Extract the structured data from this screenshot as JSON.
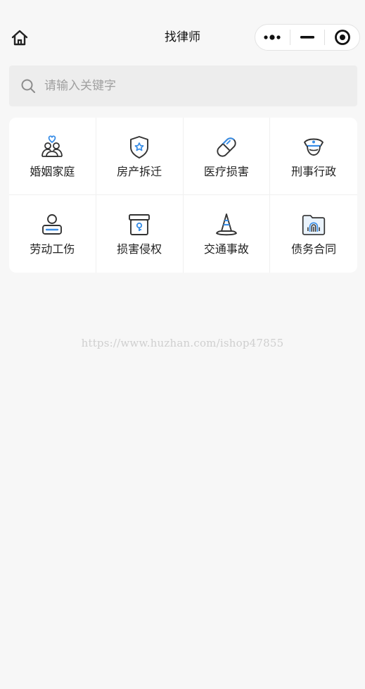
{
  "navbar": {
    "title": "找律师",
    "home_icon": "home-icon",
    "capsule": {
      "more_icon": "more-dots-icon",
      "minimize_icon": "minimize-icon",
      "close_icon": "target-circle-icon"
    }
  },
  "search": {
    "placeholder": "请输入关键字",
    "value": "",
    "icon": "search-icon"
  },
  "categories": [
    {
      "label": "婚姻家庭",
      "icon": "couple-heart-icon"
    },
    {
      "label": "房产拆迁",
      "icon": "shield-badge-icon"
    },
    {
      "label": "医疗损害",
      "icon": "pill-capsule-icon"
    },
    {
      "label": "刑事行政",
      "icon": "police-cap-icon"
    },
    {
      "label": "劳动工伤",
      "icon": "worker-person-icon"
    },
    {
      "label": "损害侵权",
      "icon": "evidence-box-icon"
    },
    {
      "label": "交通事故",
      "icon": "traffic-cone-icon"
    },
    {
      "label": "债务合同",
      "icon": "folder-fingerprint-icon"
    }
  ],
  "watermark": "https://www.huzhan.com/ishop47855",
  "colors": {
    "accent": "#3a8ee6",
    "background": "#f7f7f7",
    "card": "#ffffff",
    "search_bg": "#ededed"
  }
}
